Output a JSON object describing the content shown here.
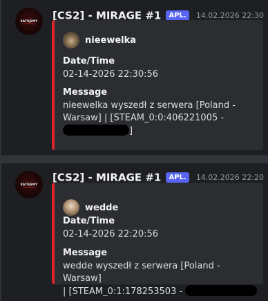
{
  "messages": [
    {
      "author": "[CS2] - MIRAGE #1",
      "tag": "APL.",
      "timestamp": "14.02.2026 22:30",
      "avatar_text": "KATUJEMY",
      "embed": {
        "author": "nieewelka",
        "field1_name": "Date/Time",
        "field1_value": "02-14-2026 22:30:56",
        "field2_name": "Message",
        "field2_line1": "nieewelka wyszedł z serwera [Poland -",
        "field2_line2": "Warsaw] | [STEAM_0:0:406221005 -",
        "field2_line3_end": "]"
      }
    },
    {
      "author": "[CS2] - MIRAGE #1",
      "tag": "APL.",
      "timestamp": "14.02.2026 22:20",
      "avatar_text": "KATUJEMY",
      "embed": {
        "author": "wedde",
        "field1_name": "Date/Time",
        "field1_value": "02-14-2026 22:20:56",
        "field2_name": "Message",
        "field2_line1": "wedde wyszedł z serwera [Poland - Warsaw]",
        "field2_line2": "| [STEAM_0:1:178253503 -"
      }
    }
  ],
  "colors": {
    "accent": "#e0242b",
    "tag": "#5865f2",
    "background": "#1e1f22",
    "embed": "#2b2d31"
  }
}
